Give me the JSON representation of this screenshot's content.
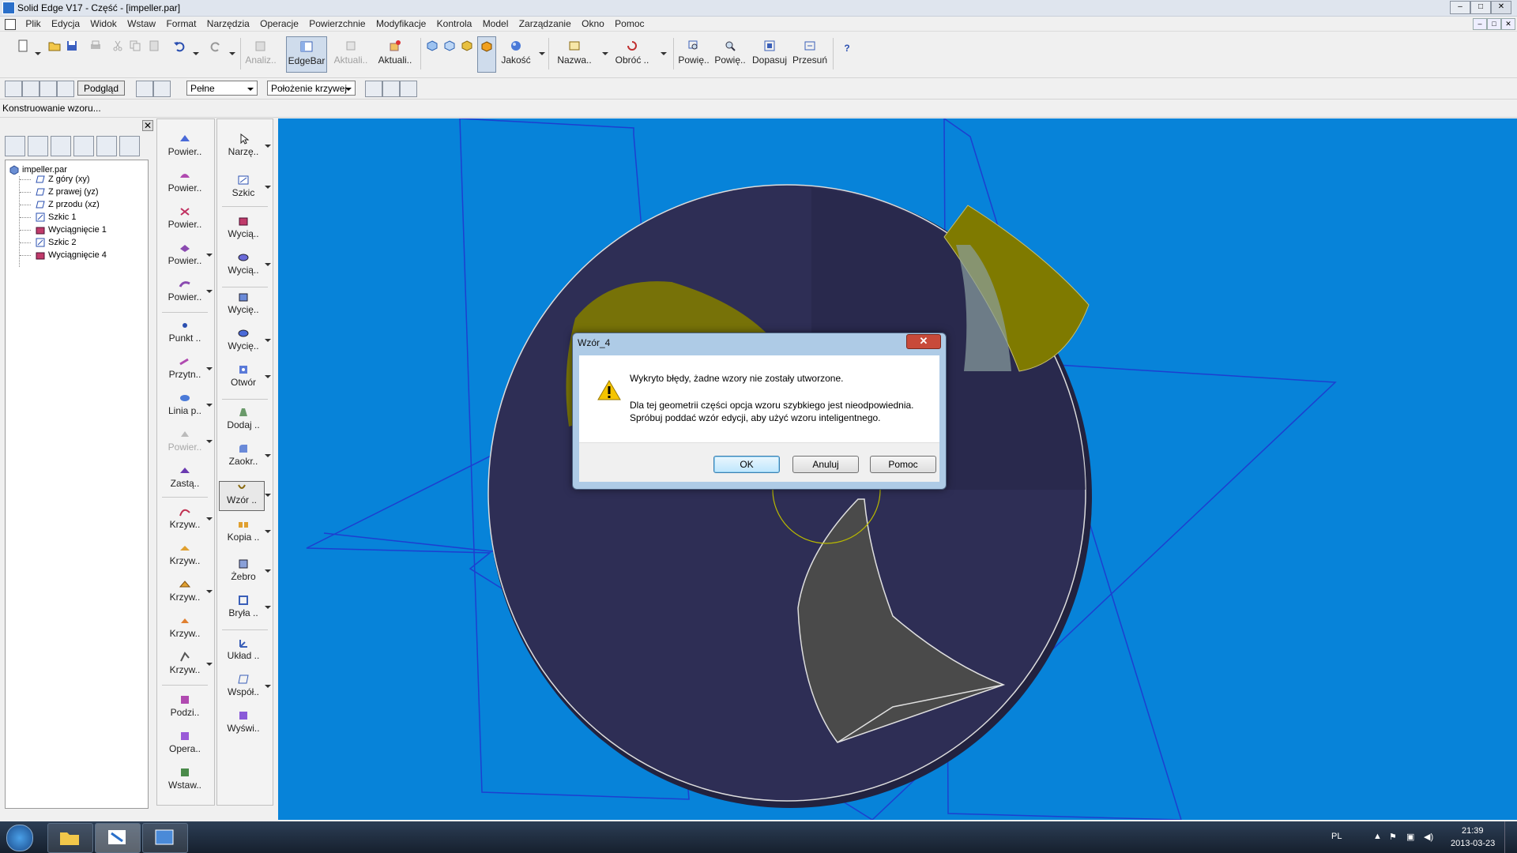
{
  "window": {
    "title": "Solid Edge V17 - Część - [impeller.par]",
    "min_label": "–",
    "max_label": "□",
    "close_label": "✕"
  },
  "menu": [
    "Plik",
    "Edycja",
    "Widok",
    "Wstaw",
    "Format",
    "Narzędzia",
    "Operacje",
    "Powierzchnie",
    "Modyfikacje",
    "Kontrola",
    "Model",
    "Zarządzanie",
    "Okno",
    "Pomoc"
  ],
  "toolbar": {
    "analysis": "Analiz..",
    "edgebar": "EdgeBar",
    "update1": "Aktuali..",
    "update2": "Aktuali..",
    "quality": "Jakość",
    "name": "Nazwa..",
    "rotate": "Obróć ..",
    "zoom1": "Powię..",
    "zoom2": "Powię..",
    "fit": "Dopasuj",
    "pan": "Przesuń",
    "help": "?"
  },
  "toolbar2": {
    "preview": "Podgląd",
    "display_mode": "Pełne",
    "curve_position": "Położenie krzywej"
  },
  "status": "Konstruowanie wzoru...",
  "tree": {
    "root": "impeller.par",
    "items": [
      "Z góry (xy)",
      "Z prawej (yz)",
      "Z przodu (xz)",
      "Szkic 1",
      "Wyciągnięcie 1",
      "Szkic 2",
      "Wyciągnięcie 4"
    ]
  },
  "ribbon_left": [
    "Powier..",
    "Powier..",
    "Powier..",
    "Powier..",
    "Powier..",
    "Punkt ..",
    "Przytn..",
    "Linia p..",
    "Powier..",
    "Zastą..",
    "Krzyw..",
    "Krzyw..",
    "Krzyw..",
    "Krzyw..",
    "Krzyw..",
    "Podzi..",
    "Opera..",
    "Wstaw.."
  ],
  "ribbon_right": [
    "Narzę..",
    "Szkic",
    "Wycią..",
    "Wycią..",
    "Wycię..",
    "Wycię..",
    "Otwór",
    "Dodaj ..",
    "Zaokr..",
    "Wzór ..",
    "Kopia ..",
    "Żebro",
    "Bryła ..",
    "Układ ..",
    "Współ..",
    "Wyświ.."
  ],
  "dialog": {
    "title": "Wzór_4",
    "line1": "Wykryto błędy, żadne wzory nie zostały utworzone.",
    "line2": "Dla tej geometrii części opcja wzoru szybkiego jest nieodpowiednia.",
    "line3": "Spróbuj poddać wzór edycji, aby użyć wzoru inteligentnego.",
    "ok": "OK",
    "cancel": "Anuluj",
    "help": "Pomoc",
    "close": "✕"
  },
  "taskbar": {
    "lang": "PL",
    "time": "21:39",
    "date": "2013-03-23"
  },
  "colors": {
    "viewport": "#0783d9",
    "disk": "#2e2e55",
    "blade": "#7f7a00",
    "plane": "#1d3fd0"
  }
}
